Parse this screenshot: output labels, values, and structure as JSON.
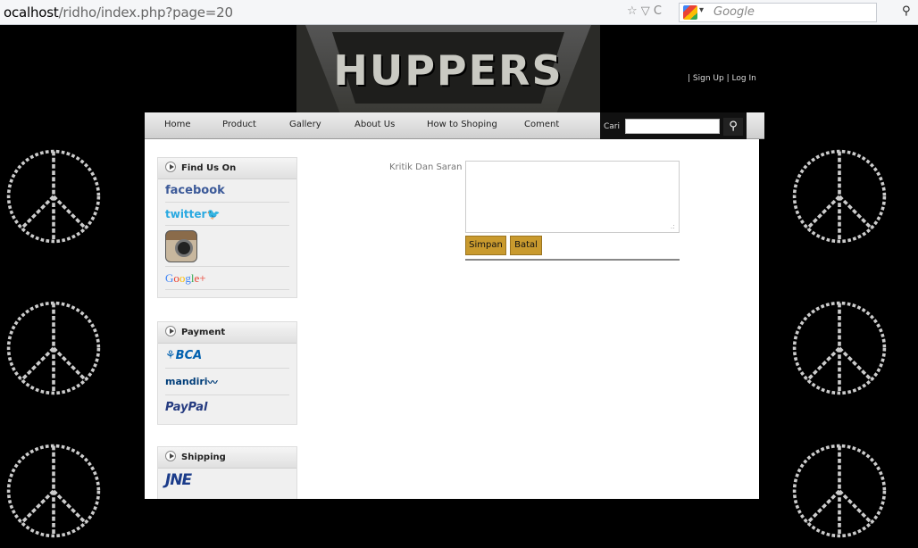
{
  "browser": {
    "url_host": "ocalhost",
    "url_path": "/ridho/index.php?page=20",
    "search_engine": "Google",
    "nav_icons": "☆ ▽ C"
  },
  "header": {
    "logo_text": "HUPPERS",
    "sign_up": "Sign Up",
    "separator": "|",
    "log_in": "Log In"
  },
  "nav": {
    "items": [
      "Home",
      "Product",
      "Gallery",
      "About Us",
      "How to Shoping",
      "Coment"
    ],
    "search_label": "Cari",
    "search_value": ""
  },
  "sidebar": {
    "find_us": {
      "title": "Find Us On",
      "facebook": "facebook",
      "twitter": "twitter",
      "google_letters": [
        "G",
        "o",
        "o",
        "g",
        "l",
        "e"
      ],
      "google_plus": "+"
    },
    "payment": {
      "title": "Payment",
      "bca": "BCA",
      "mandiri": "mandiri",
      "paypal_1": "Pay",
      "paypal_2": "Pal"
    },
    "shipping": {
      "title": "Shipping",
      "jne": "JNE"
    }
  },
  "form": {
    "label": "Kritik Dan Saran",
    "textarea_value": "",
    "submit": "Simpan",
    "cancel": "Batal"
  },
  "colors": {
    "nav_bg": "#dcdcdc",
    "button": "#c99a2e",
    "page_bg": "#000000"
  }
}
